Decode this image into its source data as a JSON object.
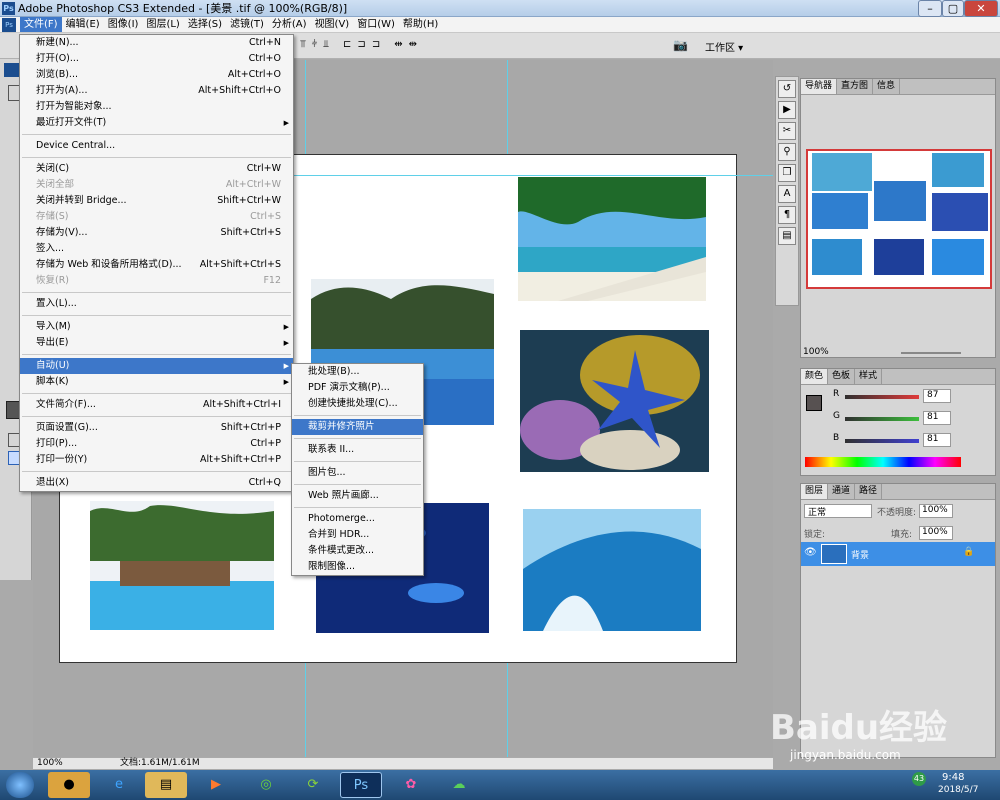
{
  "window": {
    "title": "Adobe Photoshop CS3 Extended - [美景 .tif @ 100%(RGB/8)]",
    "logo": "Ps"
  },
  "menubar": [
    "文件(F)",
    "编辑(E)",
    "图像(I)",
    "图层(L)",
    "选择(S)",
    "滤镜(T)",
    "分析(A)",
    "视图(V)",
    "窗口(W)",
    "帮助(H)"
  ],
  "optbar": {
    "workspace_label": "工作区 ▾"
  },
  "file_menu": [
    {
      "label": "新建(N)...",
      "shortcut": "Ctrl+N"
    },
    {
      "label": "打开(O)...",
      "shortcut": "Ctrl+O"
    },
    {
      "label": "浏览(B)...",
      "shortcut": "Alt+Ctrl+O"
    },
    {
      "label": "打开为(A)...",
      "shortcut": "Alt+Shift+Ctrl+O"
    },
    {
      "label": "打开为智能对象...",
      "shortcut": ""
    },
    {
      "label": "最近打开文件(T)",
      "shortcut": "",
      "submenu": true,
      "sep_after": true
    },
    {
      "label": "Device Central...",
      "shortcut": "",
      "sep_after": true
    },
    {
      "label": "关闭(C)",
      "shortcut": "Ctrl+W"
    },
    {
      "label": "关闭全部",
      "shortcut": "Alt+Ctrl+W",
      "disabled": true
    },
    {
      "label": "关闭并转到 Bridge...",
      "shortcut": "Shift+Ctrl+W"
    },
    {
      "label": "存储(S)",
      "shortcut": "Ctrl+S",
      "disabled": true
    },
    {
      "label": "存储为(V)...",
      "shortcut": "Shift+Ctrl+S"
    },
    {
      "label": "签入...",
      "shortcut": ""
    },
    {
      "label": "存储为 Web 和设备所用格式(D)...",
      "shortcut": "Alt+Shift+Ctrl+S"
    },
    {
      "label": "恢复(R)",
      "shortcut": "F12",
      "disabled": true,
      "sep_after": true
    },
    {
      "label": "置入(L)...",
      "shortcut": "",
      "sep_after": true
    },
    {
      "label": "导入(M)",
      "shortcut": "",
      "submenu": true
    },
    {
      "label": "导出(E)",
      "shortcut": "",
      "submenu": true,
      "sep_after": true
    },
    {
      "label": "自动(U)",
      "shortcut": "",
      "submenu": true,
      "highlighted": true
    },
    {
      "label": "脚本(K)",
      "shortcut": "",
      "submenu": true,
      "sep_after": true
    },
    {
      "label": "文件简介(F)...",
      "shortcut": "Alt+Shift+Ctrl+I",
      "sep_after": true
    },
    {
      "label": "页面设置(G)...",
      "shortcut": "Shift+Ctrl+P"
    },
    {
      "label": "打印(P)...",
      "shortcut": "Ctrl+P"
    },
    {
      "label": "打印一份(Y)",
      "shortcut": "Alt+Shift+Ctrl+P",
      "sep_after": true
    },
    {
      "label": "退出(X)",
      "shortcut": "Ctrl+Q"
    }
  ],
  "automate_menu": [
    {
      "label": "批处理(B)..."
    },
    {
      "label": "PDF 演示文稿(P)..."
    },
    {
      "label": "创建快捷批处理(C)...",
      "sep_after": true
    },
    {
      "label": "裁剪并修齐照片",
      "highlighted": true,
      "sep_after": true
    },
    {
      "label": "联系表 II...",
      "sep_after": true
    },
    {
      "label": "图片包...",
      "sep_after": true
    },
    {
      "label": "Web 照片画廊...",
      "sep_after": true
    },
    {
      "label": "Photomerge..."
    },
    {
      "label": "合并到 HDR..."
    },
    {
      "label": "条件模式更改..."
    },
    {
      "label": "限制图像..."
    }
  ],
  "statusbar": {
    "zoom": "100%",
    "doc": "文档:1.61M/1.61M"
  },
  "navigator": {
    "tabs": [
      "导航器",
      "直方图",
      "信息"
    ],
    "zoom": "100%"
  },
  "color_panel": {
    "tabs": [
      "颜色",
      "色板",
      "样式"
    ],
    "channels": [
      {
        "label": "R",
        "value": "87"
      },
      {
        "label": "G",
        "value": "81"
      },
      {
        "label": "B",
        "value": "81"
      }
    ]
  },
  "layers_panel": {
    "tabs": [
      "图层",
      "通道",
      "路径"
    ],
    "blend_mode": "正常",
    "opacity_label": "不透明度:",
    "opacity": "100%",
    "lock_label": "锁定:",
    "fill_label": "填充:",
    "fill": "100%",
    "layer_name": "背景"
  },
  "taskbar": {
    "time": "9:48",
    "date": "2018/5/7",
    "badge": "43"
  },
  "watermark": {
    "brand": "Baidu经验",
    "url": "jingyan.baidu.com"
  }
}
